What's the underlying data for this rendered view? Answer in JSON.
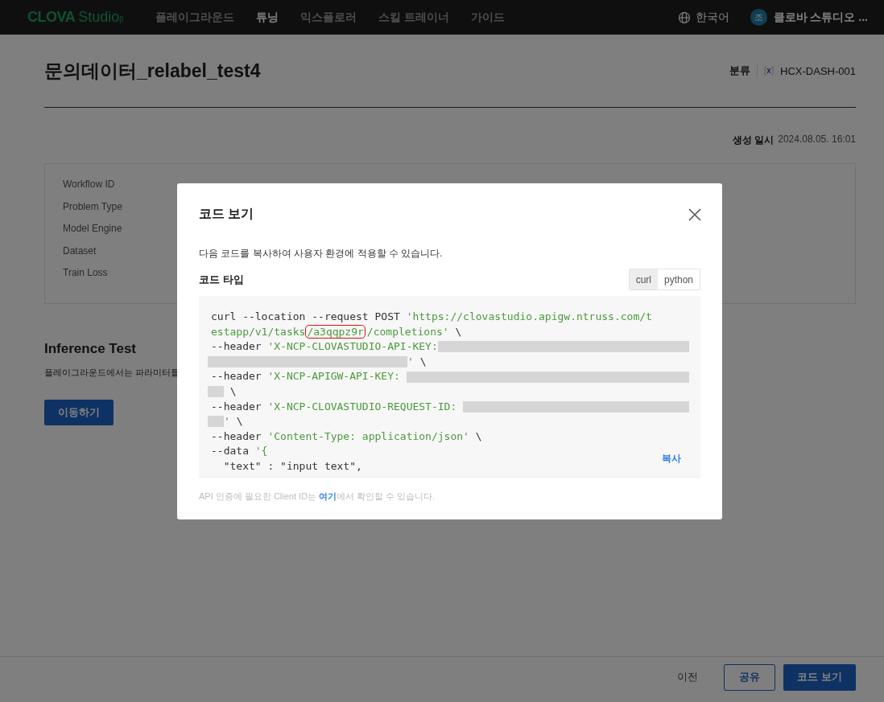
{
  "nav": {
    "logo": {
      "brand": "CLOVA",
      "product": "Studio",
      "badge": "β"
    },
    "menu": [
      {
        "label": "플레이그라운드",
        "selected": false
      },
      {
        "label": "튜닝",
        "selected": true
      },
      {
        "label": "익스플로러",
        "selected": false
      },
      {
        "label": "스킬 트레이너",
        "selected": false
      },
      {
        "label": "가이드",
        "selected": false
      }
    ],
    "language": "한국어",
    "user": {
      "initial": "조",
      "name": "클로바 스튜디오 ..."
    }
  },
  "page": {
    "title": "문의데이터_relabel_test4",
    "category_label": "분류",
    "model": "HCX-DASH-001",
    "created_label": "생성 일시",
    "created": "2024.08.05. 16:01",
    "info_labels": [
      "Workflow ID",
      "Problem Type",
      "Model Engine",
      "Dataset",
      "Train Loss"
    ],
    "inference": {
      "title": "Inference Test",
      "description": "플레이그라운드에서는 파라미터를",
      "button": "이동하기"
    }
  },
  "footer": {
    "prev": "이전",
    "share": "공유",
    "code": "코드 보기"
  },
  "modal": {
    "title": "코드 보기",
    "description": "다음 코드를 복사하여 사용자 환경에 적용할 수 있습니다.",
    "type_label": "코드 타입",
    "tabs": [
      {
        "label": "curl",
        "selected": true
      },
      {
        "label": "python",
        "selected": false
      }
    ],
    "code_lines": [
      [
        {
          "kind": "plain",
          "text": "curl --location --request POST "
        },
        {
          "kind": "string",
          "text": "'https://clovastudio.apigw.ntruss.com/t"
        }
      ],
      [
        {
          "kind": "string",
          "text": "estapp/v1/tasks"
        },
        {
          "kind": "highlight",
          "text": "/a3qqpz9r"
        },
        {
          "kind": "string",
          "text": "/completions'"
        },
        {
          "kind": "plain",
          "text": " \\"
        }
      ],
      [
        {
          "kind": "plain",
          "text": "--header "
        },
        {
          "kind": "string",
          "text": "'X-NCP-CLOVASTUDIO-API-KEY:"
        },
        {
          "kind": "maskfill"
        }
      ],
      [
        {
          "kind": "maskwide"
        },
        {
          "kind": "string",
          "text": "'"
        },
        {
          "kind": "plain",
          "text": " \\"
        }
      ],
      [
        {
          "kind": "plain",
          "text": "--header "
        },
        {
          "kind": "string",
          "text": "'X-NCP-APIGW-API-KEY: "
        },
        {
          "kind": "maskfill"
        }
      ],
      [
        {
          "kind": "maskshort"
        },
        {
          "kind": "plain",
          "text": " \\"
        }
      ],
      [
        {
          "kind": "plain",
          "text": "--header "
        },
        {
          "kind": "string",
          "text": "'X-NCP-CLOVASTUDIO-REQUEST-ID: "
        },
        {
          "kind": "maskfill"
        }
      ],
      [
        {
          "kind": "maskshort"
        },
        {
          "kind": "string",
          "text": "'"
        },
        {
          "kind": "plain",
          "text": " \\"
        }
      ],
      [
        {
          "kind": "plain",
          "text": "--header "
        },
        {
          "kind": "string",
          "text": "'Content-Type: application/json'"
        },
        {
          "kind": "plain",
          "text": " \\"
        }
      ],
      [
        {
          "kind": "plain",
          "text": "--data "
        },
        {
          "kind": "string",
          "text": "'{"
        }
      ],
      [
        {
          "kind": "plain",
          "text": "  \"text\" : \"input text\","
        }
      ]
    ],
    "copy": "복사",
    "note": {
      "before": "API 인증에 필요한 Client ID는 ",
      "link": "여기",
      "after": "에서 확인할 수 있습니다."
    }
  }
}
